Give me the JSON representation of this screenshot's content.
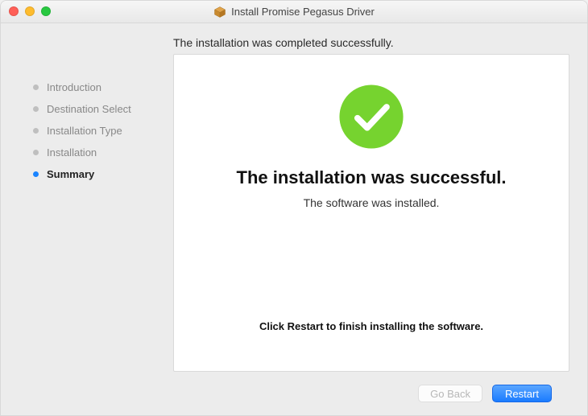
{
  "window": {
    "title": "Install Promise Pegasus Driver"
  },
  "subtitle": "The installation was completed successfully.",
  "sidebar": {
    "steps": [
      {
        "label": "Introduction",
        "active": false
      },
      {
        "label": "Destination Select",
        "active": false
      },
      {
        "label": "Installation Type",
        "active": false
      },
      {
        "label": "Installation",
        "active": false
      },
      {
        "label": "Summary",
        "active": true
      }
    ]
  },
  "content": {
    "heading": "The installation was successful.",
    "subheading": "The software was installed.",
    "hint": "Click Restart to finish installing the software."
  },
  "footer": {
    "goBack": "Go Back",
    "restart": "Restart"
  },
  "colors": {
    "accent": "#1a7bff",
    "success": "#76d32f"
  }
}
